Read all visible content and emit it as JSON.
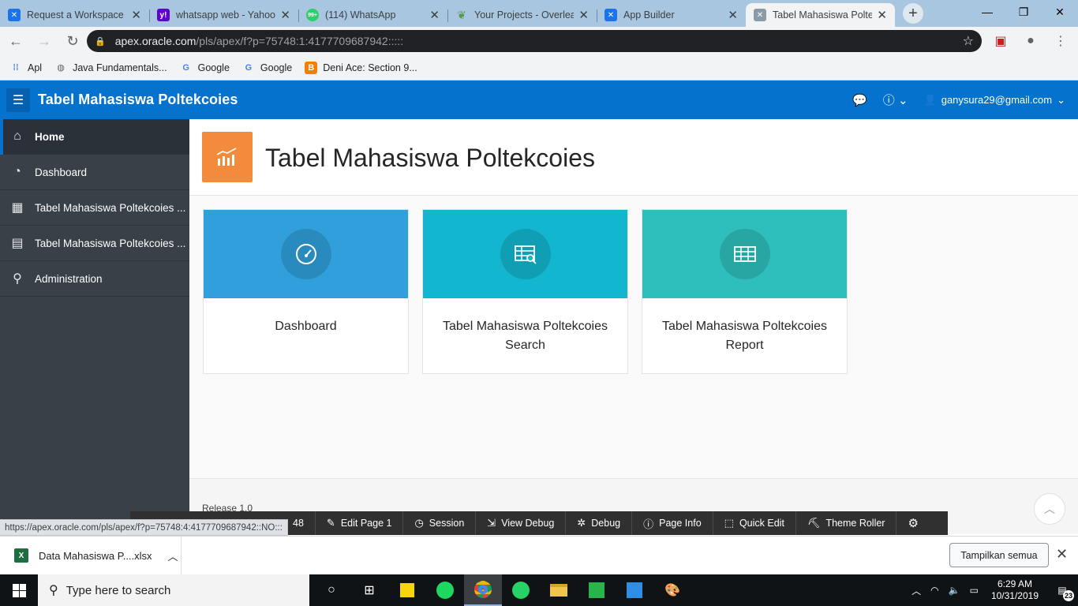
{
  "browser": {
    "tabs": [
      {
        "title": "Request a Workspace -",
        "favicon": "apex-logo-icon",
        "color": "#1a73e8"
      },
      {
        "title": "whatsapp web - Yahoo",
        "favicon": "yahoo-icon",
        "color": "#5f01d1"
      },
      {
        "title": "(114) WhatsApp",
        "favicon": "whatsapp-icon",
        "color": "#25d366",
        "badge": "99+"
      },
      {
        "title": "Your Projects - Overleaf",
        "favicon": "overleaf-icon",
        "color": "#4f9c45"
      },
      {
        "title": "App Builder",
        "favicon": "apex-logo-icon",
        "color": "#1a73e8"
      },
      {
        "title": "Tabel Mahasiswa Poltek",
        "favicon": "apex-logo-icon",
        "color": "#8a9aa8",
        "active": true
      }
    ],
    "url_host": "apex.oracle.com",
    "url_path": "/pls/apex/f?p=75748:1:4177709687942:::::",
    "bookmarks": [
      {
        "label": "Apl",
        "icon": "apps-grid-icon"
      },
      {
        "label": "Java Fundamentals...",
        "icon": "globe-icon"
      },
      {
        "label": "Google",
        "icon": "google-icon"
      },
      {
        "label": "Google",
        "icon": "google-icon"
      },
      {
        "label": "Deni Ace: Section 9...",
        "icon": "blogger-icon"
      }
    ]
  },
  "header": {
    "app_title": "Tabel Mahasiswa Poltekcoies",
    "user_email": "ganysura29@gmail.com"
  },
  "sidebar": {
    "items": [
      {
        "label": "Home",
        "icon": "home-icon",
        "active": true
      },
      {
        "label": "Dashboard",
        "icon": "dashboard-icon"
      },
      {
        "label": "Tabel Mahasiswa Poltekcoies ...",
        "icon": "table-search-icon"
      },
      {
        "label": "Tabel Mahasiswa Poltekcoies ...",
        "icon": "table-icon"
      },
      {
        "label": "Administration",
        "icon": "user-wrench-icon"
      }
    ]
  },
  "main": {
    "title": "Tabel Mahasiswa Poltekcoies",
    "cards": [
      {
        "label": "Dashboard",
        "color": "#309fdb",
        "icon": "dashboard-icon"
      },
      {
        "label": "Tabel Mahasiswa Poltekcoies Search",
        "color": "#13b6cf",
        "icon": "table-search-icon"
      },
      {
        "label": "Tabel Mahasiswa Poltekcoies Report",
        "color": "#2ebfbc",
        "icon": "table-icon"
      }
    ],
    "release": "Release 1.0"
  },
  "devbar": {
    "app_suffix": "48",
    "items": [
      "Edit Page 1",
      "Session",
      "View Debug",
      "Debug",
      "Page Info",
      "Quick Edit",
      "Theme Roller"
    ]
  },
  "status_url": "https://apex.oracle.com/pls/apex/f?p=75748:4:4177709687942::NO:::",
  "download": {
    "filename": "Data Mahasiswa P....xlsx",
    "show_all": "Tampilkan semua"
  },
  "taskbar": {
    "search_placeholder": "Type here to search",
    "time": "6:29 AM",
    "date": "10/31/2019",
    "notifications": "23"
  }
}
